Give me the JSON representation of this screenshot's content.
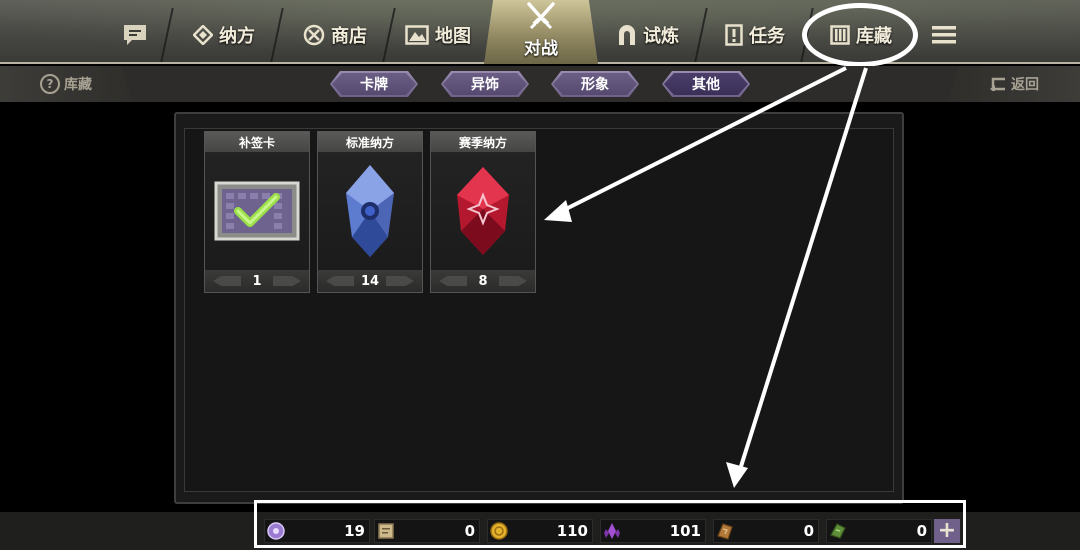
{
  "nav": {
    "tabs": [
      {
        "label": "纳方",
        "icon": "diamond-icon"
      },
      {
        "label": "商店",
        "icon": "shop-icon"
      },
      {
        "label": "地图",
        "icon": "map-icon"
      },
      {
        "label": "对战",
        "icon": "crossed-swords-icon"
      },
      {
        "label": "试炼",
        "icon": "arch-icon"
      },
      {
        "label": "任务",
        "icon": "quest-icon"
      },
      {
        "label": "库藏",
        "icon": "collection-icon"
      }
    ],
    "left_icon": "message-icon",
    "menu_icon": "hamburger-icon"
  },
  "subbar": {
    "left_label": "库藏",
    "right_label": "返回",
    "pills": [
      "卡牌",
      "异饰",
      "形象",
      "其他"
    ],
    "active_pill": "其他"
  },
  "items": [
    {
      "name": "补签卡",
      "count": "1",
      "icon": "checkin-card-icon"
    },
    {
      "name": "标准纳方",
      "count": "14",
      "icon": "blue-crystal-icon"
    },
    {
      "name": "赛季纳方",
      "count": "8",
      "icon": "red-crystal-icon"
    }
  ],
  "resources": [
    {
      "icon": "purple-orb-icon",
      "value": "19"
    },
    {
      "icon": "scroll-icon",
      "value": "0"
    },
    {
      "icon": "gold-coin-icon",
      "value": "110"
    },
    {
      "icon": "purple-crystal-icon",
      "value": "101"
    },
    {
      "icon": "bronze-shard-icon",
      "value": "0"
    },
    {
      "icon": "green-shard-icon",
      "value": "0"
    }
  ],
  "colors": {
    "accent_purple": "#6f6189",
    "nav_text": "#f2ecdb",
    "annotation": "#ffffff"
  }
}
